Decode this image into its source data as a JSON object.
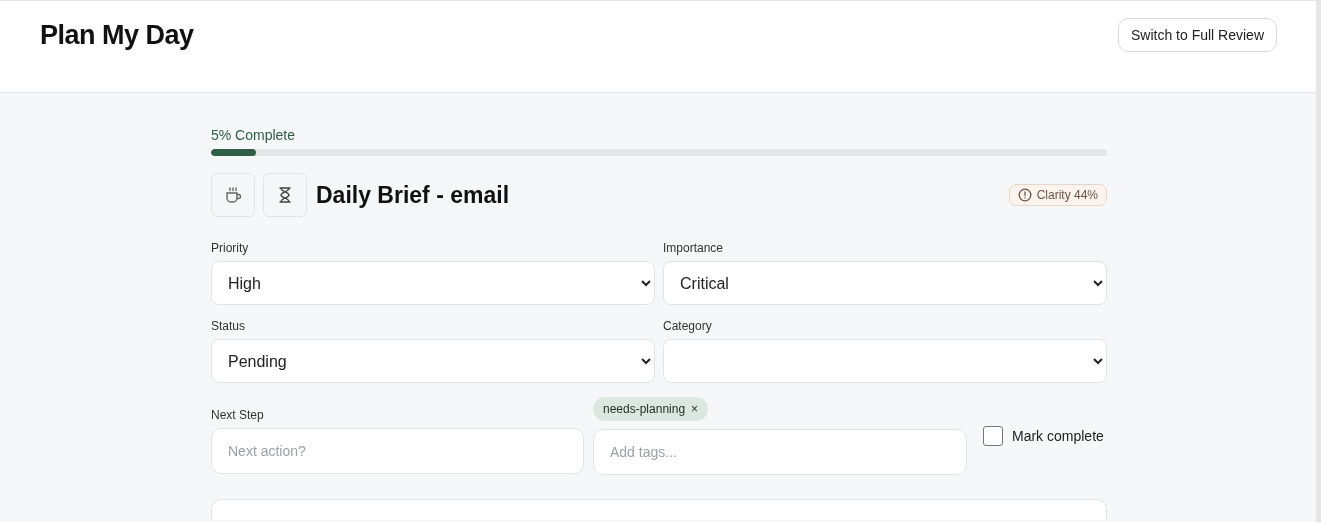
{
  "header": {
    "title": "Plan My Day",
    "button": "Switch to Full Review"
  },
  "progress": {
    "label": "5% Complete",
    "level": 0.05
  },
  "task": {
    "title": "Daily Brief - email",
    "clarity": "Clarity 44%"
  },
  "selects": [
    {
      "label": "Priority",
      "value": "High"
    },
    {
      "label": "Importance",
      "value": "Critical"
    },
    {
      "label": "Status",
      "value": "Pending"
    },
    {
      "label": "Category"
    }
  ],
  "next_step": {
    "label": "Next Step",
    "placeholder": "Next action?"
  },
  "tags": {
    "items": [
      {
        "label": "needs-planning",
        "remove": "×"
      }
    ],
    "placeholder": "Add tags..."
  },
  "mark_complete": {
    "label": "Mark complete",
    "checked": false
  }
}
